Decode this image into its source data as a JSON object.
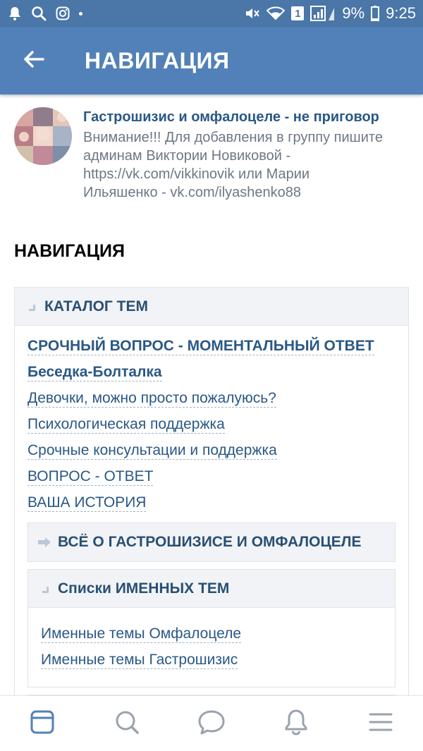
{
  "status_bar": {
    "battery_percent": "9%",
    "time": "9:25",
    "sim_badge": "1",
    "icons": [
      "notification-bell-icon",
      "search-icon",
      "instagram-icon",
      "mute-icon",
      "wifi-icon",
      "signal-icon",
      "battery-icon"
    ]
  },
  "app_bar": {
    "title": "НАВИГАЦИЯ",
    "back_icon": "arrow-left-icon"
  },
  "group": {
    "name": "Гастрошизис и омфалоцеле - не приговор",
    "description_lines": [
      "Внимание!!! Для добавления в группу пишите",
      "админам Виктории Новиковой -",
      "https://vk.com/vikkinovik или Марии",
      "Ильяшенко - vk.com/ilyashenko88"
    ]
  },
  "navigation": {
    "heading": "НАВИГАЦИЯ",
    "catalog": {
      "title": "КАТАЛОГ ТЕМ",
      "links": [
        {
          "label": "СРОЧНЫЙ ВОПРОС - МОМЕНТАЛЬНЫЙ ОТВЕТ",
          "bold": true
        },
        {
          "label": "Беседка-Болталка",
          "bold": true
        },
        {
          "label": "Девочки, можно просто пожалуюсь?",
          "bold": false
        },
        {
          "label": "Психологическая поддержка",
          "bold": false
        },
        {
          "label": "Срочные консультации и поддержка",
          "bold": false
        },
        {
          "label": "ВОПРОС - ОТВЕТ",
          "bold": false
        },
        {
          "label": "ВАША ИСТОРИЯ",
          "bold": false
        }
      ]
    },
    "all_about": {
      "title": "ВСЁ О ГАСТРОШИЗИСЕ И ОМФАЛОЦЕЛЕ"
    },
    "named_topics": {
      "title": "Списки ИМЕННЫХ ТЕМ",
      "links": [
        "Именные темы Омфалоцеле",
        "Именные темы Гастрошизис"
      ]
    }
  },
  "tab_bar": {
    "items": [
      "news-icon",
      "search-icon",
      "messages-icon",
      "notifications-icon",
      "menu-icon"
    ],
    "active_color": "#5181b8",
    "inactive_color": "#99a2ad"
  },
  "colors": {
    "header": "#5181b8",
    "status": "#4a76a8",
    "link": "#2a5885"
  }
}
